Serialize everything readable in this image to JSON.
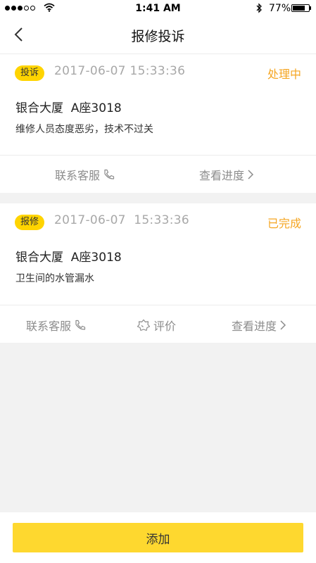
{
  "status_bar": {
    "time": "1:41 AM",
    "battery_percent": "77%",
    "battery_level": 0.77,
    "icons": [
      "signal-dots-icon",
      "wifi-icon",
      "bluetooth-icon",
      "battery-icon"
    ]
  },
  "nav": {
    "title": "报修投诉",
    "back_icon": "chevron-left-icon"
  },
  "records": [
    {
      "type_label": "投诉",
      "datetime": "2017-06-07 15:33:36",
      "status": "处理中",
      "location": "银合大厦  A座3018",
      "description": "维修人员态度恶劣，技术不过关",
      "actions": {
        "contact": "联系客服",
        "progress": "查看进度"
      }
    },
    {
      "type_label": "报修",
      "datetime": "2017-06-07  15:33:36",
      "status": "已完成",
      "location": "银合大厦  A座3018",
      "description": "卫生间的水管漏水",
      "actions": {
        "contact": "联系客服",
        "rate": "评价",
        "progress": "查看进度"
      }
    }
  ],
  "colors": {
    "accent": "#ffd400",
    "button": "#fed82f",
    "status": "#f5a623",
    "muted": "#8c8c8c",
    "background": "#f2f2f2"
  },
  "add_button": {
    "label": "添加"
  }
}
